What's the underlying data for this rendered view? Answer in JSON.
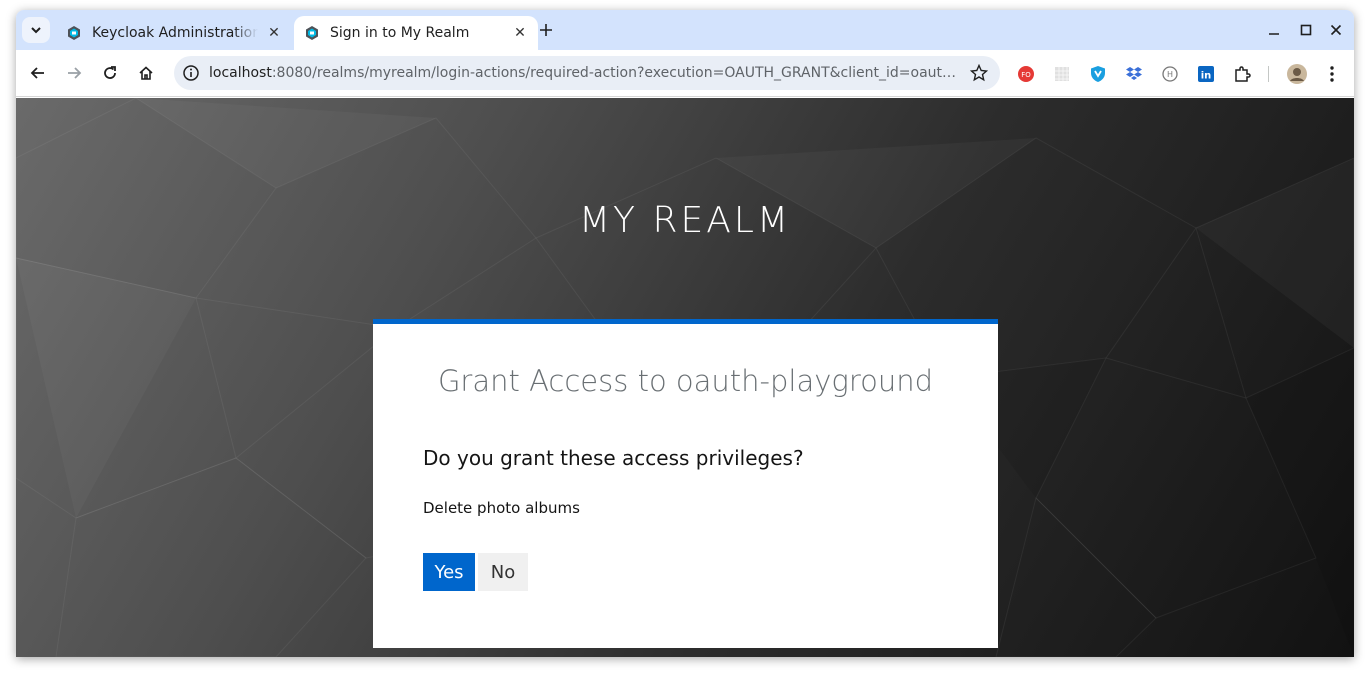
{
  "browser": {
    "tabs": [
      {
        "title": "Keycloak Administration",
        "active": false
      },
      {
        "title": "Sign in to My Realm",
        "active": true
      }
    ],
    "address": {
      "host": "localhost",
      "rest": ":8080/realms/myrealm/login-actions/required-action?execution=OAUTH_GRANT&client_id=oauth-playgro..."
    },
    "extensions": [
      {
        "name": "fo-extension-icon",
        "color": "#e53935"
      },
      {
        "name": "grid-extension-icon",
        "color": "#cccccc"
      },
      {
        "name": "shield-extension-icon",
        "color": "#1a9fe0"
      },
      {
        "name": "dropbox-extension-icon",
        "color": "#3a6fd8"
      },
      {
        "name": "h-extension-icon",
        "color": "#777777"
      },
      {
        "name": "linkedin-extension-icon",
        "color": "#0a66c2"
      },
      {
        "name": "puzzle-extension-icon",
        "color": "#333333"
      }
    ]
  },
  "page": {
    "realm_title": "MY REALM",
    "card_title": "Grant Access to oauth-playground",
    "question": "Do you grant these access privileges?",
    "scope": "Delete photo albums",
    "yes_label": "Yes",
    "no_label": "No",
    "accent": "#0066cc"
  }
}
